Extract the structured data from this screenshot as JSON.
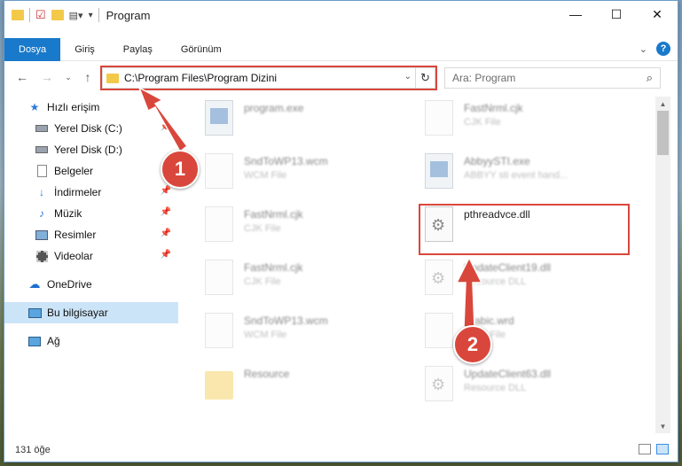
{
  "window": {
    "title": "Program",
    "controls": {
      "minimize": "—",
      "maximize": "☐",
      "close": "✕"
    }
  },
  "ribbon": {
    "tabs": [
      {
        "label": "Dosya",
        "active": true
      },
      {
        "label": "Giriş",
        "active": false
      },
      {
        "label": "Paylaş",
        "active": false
      },
      {
        "label": "Görünüm",
        "active": false
      }
    ],
    "help": "?"
  },
  "address": {
    "path": "C:\\Program Files\\Program Dizini"
  },
  "search": {
    "placeholder": "Ara: Program"
  },
  "sidebar": {
    "items": [
      {
        "label": "Hızlı erişim",
        "icon": "star-icon"
      },
      {
        "label": "Yerel Disk (C:)",
        "icon": "drive-icon",
        "pinned": true
      },
      {
        "label": "Yerel Disk (D:)",
        "icon": "drive-icon"
      },
      {
        "label": "Belgeler",
        "icon": "documents-icon",
        "pinned": true
      },
      {
        "label": "İndirmeler",
        "icon": "download-icon",
        "pinned": true
      },
      {
        "label": "Müzik",
        "icon": "music-icon",
        "pinned": true
      },
      {
        "label": "Resimler",
        "icon": "pictures-icon",
        "pinned": true
      },
      {
        "label": "Videolar",
        "icon": "videos-icon",
        "pinned": true
      },
      {
        "label": "OneDrive",
        "icon": "cloud-icon"
      },
      {
        "label": "Bu bilgisayar",
        "icon": "computer-icon",
        "selected": true
      },
      {
        "label": "Ağ",
        "icon": "network-icon"
      }
    ]
  },
  "files": {
    "left": [
      {
        "name": "program.exe",
        "type": ""
      },
      {
        "name": "SndToWP13.wcm",
        "type": "WCM File"
      },
      {
        "name": "FastNrml.cjk",
        "type": "CJK File"
      },
      {
        "name": "FastNrml.cjk",
        "type": "CJK File"
      },
      {
        "name": "SndToWP13.wcm",
        "type": "WCM File"
      },
      {
        "name": "Resource",
        "type": ""
      }
    ],
    "right": [
      {
        "name": "FastNrml.cjk",
        "type": "CJK File"
      },
      {
        "name": "AbbyySTI.exe",
        "type": "ABBYY sti event hand..."
      },
      {
        "name": "pthreadvce.dll",
        "type": ""
      },
      {
        "name": "UpdateClient19.dll",
        "type": "Resource DLL"
      },
      {
        "name": "Arabic.wrd",
        "type": "WRD File"
      },
      {
        "name": "UpdateClient63.dll",
        "type": "Resource DLL"
      }
    ]
  },
  "status": {
    "count": "131 öğe"
  },
  "annotations": {
    "badge1": "1",
    "badge2": "2",
    "color": "#d9473c"
  }
}
